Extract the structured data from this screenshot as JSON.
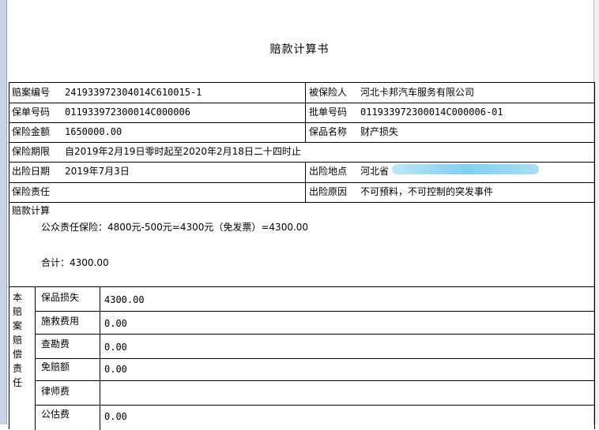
{
  "title": "赔款计算书",
  "fields": {
    "claim_no_label": "赔案编号",
    "claim_no": "241933972304014C610015-1",
    "insured_label": "被保险人",
    "insured": "河北卡邦汽车服务有限公司",
    "policy_no_label": "保单号码",
    "policy_no": "011933972300014C000006",
    "endorse_no_label": "批单号码",
    "endorse_no": "011933972300014C000006-01",
    "sum_insured_label": "保险金额",
    "sum_insured": "1650000.00",
    "goods_label": "保品名称",
    "goods": "财产损失",
    "period_label": "保险期限",
    "period": "自2019年2月19日零时起至2020年2月18日二十四时止",
    "accident_date_label": "出险日期",
    "accident_date": "2019年7月3日",
    "location_label": "出险地点",
    "location": "河北省",
    "liability_label": "保险责任",
    "cause_label": "出险原因",
    "cause": "不可预料，不可控制的突发事件"
  },
  "calc": {
    "label": "赔款计算",
    "line1": "公众责任保险：4800元-500元=4300元（免发票）=4300.00",
    "total": "合计：4300.00"
  },
  "side_label": [
    "本",
    "赔",
    "案",
    "赔",
    "偿",
    "责",
    "任"
  ],
  "breakdown": [
    {
      "label": "保品损失",
      "value": "4300.00"
    },
    {
      "label": "施救费用",
      "value": "0.00"
    },
    {
      "label": "查勘费",
      "value": "0.00"
    },
    {
      "label": "免赔额",
      "value": "0.00"
    },
    {
      "label": "律师费",
      "value": ""
    },
    {
      "label": "公估费",
      "value": "0.00"
    }
  ]
}
